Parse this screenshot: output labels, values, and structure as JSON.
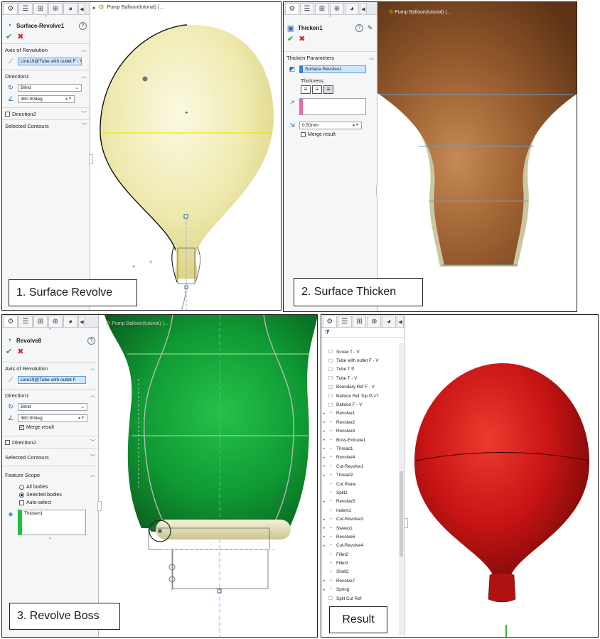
{
  "panels": {
    "p1": {
      "breadcrumb": "Pump Balloon(tutorial) (...",
      "feature_title": "Surface-Revolve1",
      "axis_section": "Axis of Revolution",
      "axis_value": "Line19@Tube with outlet F - V",
      "direction1_section": "Direction1",
      "end_condition": "Blind",
      "angle": "360.00deg",
      "direction2_section": "Direction2",
      "contours_section": "Selected Contours",
      "caption": "1. Surface Revolve",
      "body_color": "#efeab0"
    },
    "p2": {
      "breadcrumb": "Pump Balloon(tutorial) (...",
      "feature_title": "Thicken1",
      "params_section": "Thicken Parameters",
      "surface_value": "Surface-Revolve1",
      "thickness_label": "Thickness:",
      "thickness_value": "0.50mm",
      "merge_label": "Merge result",
      "caption": "2. Surface Thicken",
      "body_color": "#8a5227"
    },
    "p3": {
      "breadcrumb": "Pump Balloon(tutorial) (...",
      "feature_title": "Revolve8",
      "axis_section": "Axis of Revolution",
      "axis_value": "Line19@Tube with outlet F",
      "direction1_section": "Direction1",
      "end_condition": "Blind",
      "angle": "360.00deg",
      "merge_label": "Merge result",
      "direction2_section": "Direction2",
      "contours_section": "Selected Contours",
      "scope_section": "Feature Scope",
      "all_bodies": "All bodies",
      "selected_bodies": "Selected bodies",
      "auto_select": "Auto-select",
      "body_item": "Thicken1",
      "caption": "3. Revolve Boss",
      "body_color": "#0fa83a"
    },
    "p4": {
      "caption": "Result",
      "body_color": "#c81414",
      "tree_items": [
        {
          "label": "Screw T - V",
          "icon": "sketch"
        },
        {
          "label": "Tube with outlet F - V",
          "icon": "sketch"
        },
        {
          "label": "Tube T P",
          "icon": "sketch"
        },
        {
          "label": "Tube T - V",
          "icon": "sketch"
        },
        {
          "label": "Boundary Ref F - V",
          "icon": "sketch"
        },
        {
          "label": "Balloon Ref Top P->?",
          "icon": "sketch"
        },
        {
          "label": "Balloon F - V",
          "icon": "sketch"
        },
        {
          "label": "Revolve1",
          "icon": "feature",
          "expand": true
        },
        {
          "label": "Revolve2",
          "icon": "feature",
          "expand": true
        },
        {
          "label": "Revolve3",
          "icon": "feature",
          "expand": true
        },
        {
          "label": "Boss-Extrude1",
          "icon": "feature",
          "expand": true
        },
        {
          "label": "Thread1",
          "icon": "feature",
          "expand": true
        },
        {
          "label": "Revolve4",
          "icon": "feature",
          "expand": true
        },
        {
          "label": "Cut-Revolve1",
          "icon": "feature",
          "expand": true
        },
        {
          "label": "Thread2",
          "icon": "feature",
          "expand": true
        },
        {
          "label": "Cut Plane",
          "icon": "feature"
        },
        {
          "label": "Split1",
          "icon": "feature"
        },
        {
          "label": "Revolve5",
          "icon": "feature",
          "expand": true
        },
        {
          "label": "Indent1",
          "icon": "feature"
        },
        {
          "label": "Cut-Revolve3",
          "icon": "feature",
          "expand": true
        },
        {
          "label": "Sweep1",
          "icon": "feature",
          "expand": true
        },
        {
          "label": "Revolve6",
          "icon": "feature",
          "expand": true
        },
        {
          "label": "Cut-Revolve4",
          "icon": "feature",
          "expand": true
        },
        {
          "label": "Fillet2",
          "icon": "feature"
        },
        {
          "label": "Fillet3",
          "icon": "feature"
        },
        {
          "label": "Shell2",
          "icon": "feature"
        },
        {
          "label": "Revolve7",
          "icon": "feature",
          "expand": true
        },
        {
          "label": "Spring",
          "icon": "feature",
          "expand": true
        },
        {
          "label": "Split Cut Ref",
          "icon": "sketch"
        }
      ]
    }
  }
}
